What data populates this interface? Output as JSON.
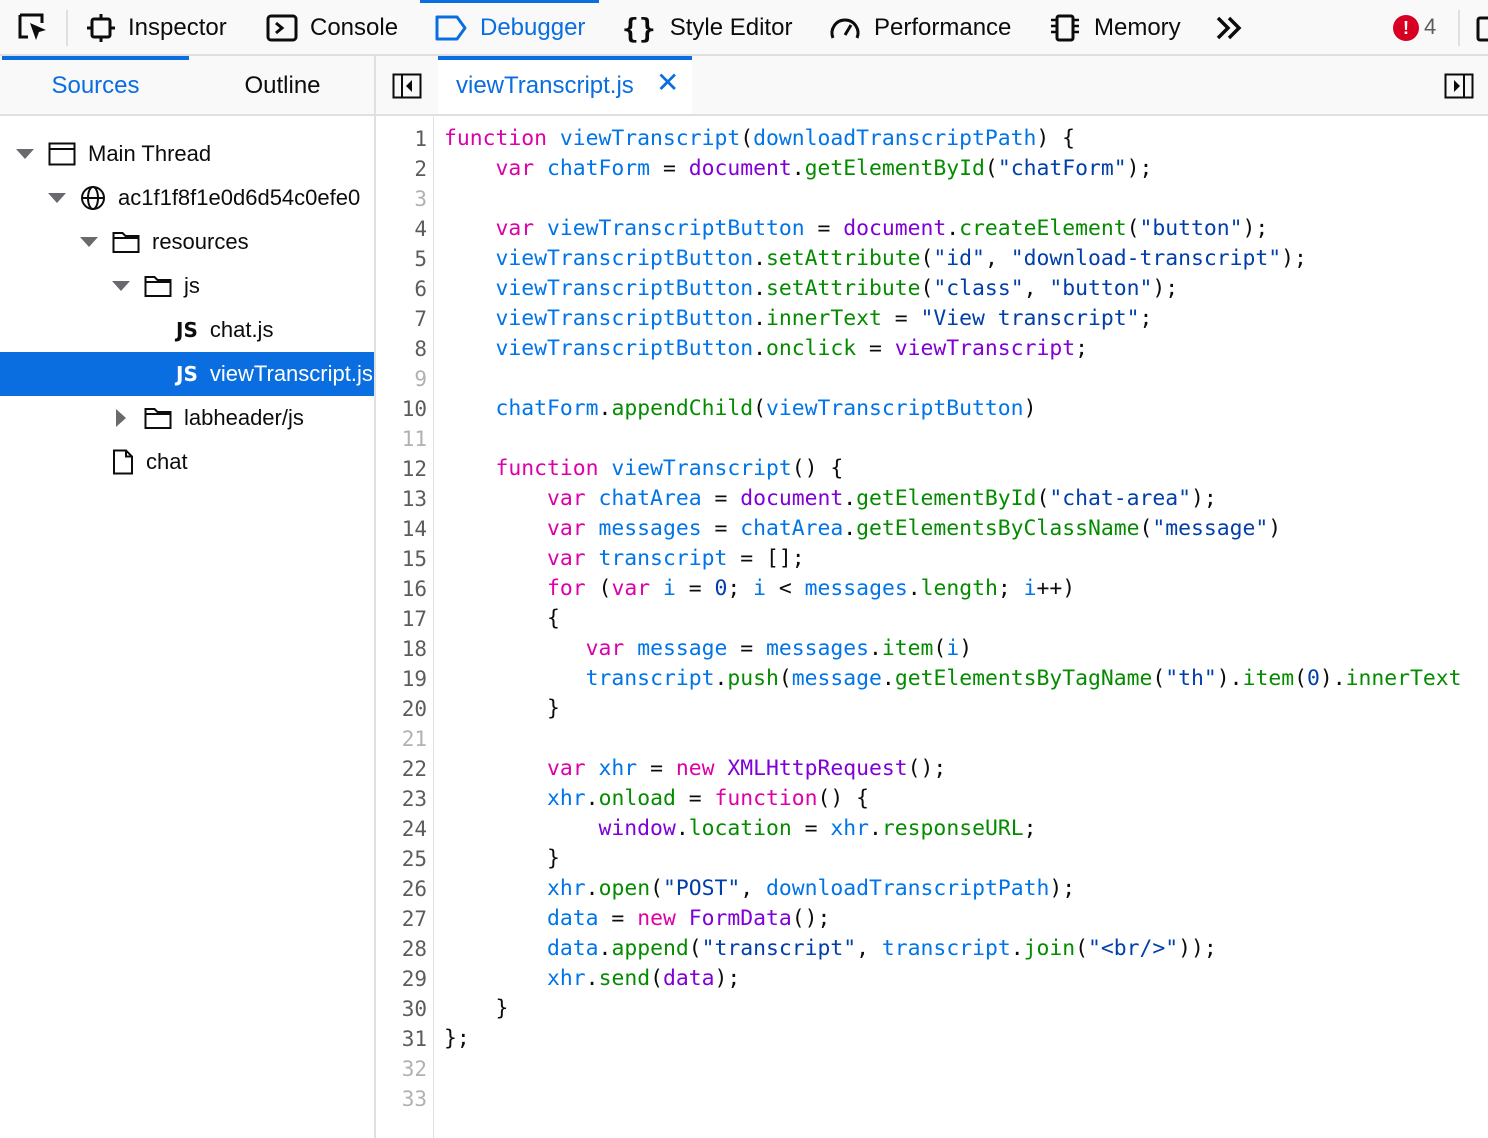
{
  "toolbar": {
    "tools": [
      {
        "id": "inspector",
        "label": "Inspector",
        "icon": "inspector-icon"
      },
      {
        "id": "console",
        "label": "Console",
        "icon": "console-icon"
      },
      {
        "id": "debugger",
        "label": "Debugger",
        "icon": "debugger-icon",
        "active": true
      },
      {
        "id": "style-editor",
        "label": "Style Editor",
        "icon": "braces-icon"
      },
      {
        "id": "performance",
        "label": "Performance",
        "icon": "gauge-icon"
      },
      {
        "id": "memory",
        "label": "Memory",
        "icon": "chip-icon"
      }
    ],
    "error_badge": "!",
    "error_count": "4",
    "accent": "#0a6ee0",
    "error_color": "#d70022"
  },
  "left_panel": {
    "tabs": [
      {
        "label": "Sources",
        "active": true
      },
      {
        "label": "Outline",
        "active": false
      }
    ],
    "tree": [
      {
        "label": "Main Thread",
        "icon": "window-icon",
        "expanded": true
      },
      {
        "label": "ac1f1f8f1e0d6d54c0efe0",
        "icon": "globe-icon",
        "expanded": true
      },
      {
        "label": "resources",
        "icon": "folder-icon",
        "expanded": true
      },
      {
        "label": "js",
        "icon": "folder-icon",
        "expanded": true
      },
      {
        "label": "chat.js",
        "icon": "js-icon"
      },
      {
        "label": "viewTranscript.js",
        "icon": "js-icon",
        "selected": true
      },
      {
        "label": "labheader/js",
        "icon": "folder-icon",
        "expanded": false
      },
      {
        "label": "chat",
        "icon": "file-icon"
      }
    ],
    "js_badge": "JS"
  },
  "editor": {
    "file_tab": "viewTranscript.js",
    "close_glyph": "✕",
    "lines": [
      [
        [
          "k",
          "function "
        ],
        [
          "v",
          "viewTranscript"
        ],
        [
          "n",
          "("
        ],
        [
          "v",
          "downloadTranscriptPath"
        ],
        [
          "n",
          ") {"
        ]
      ],
      [
        [
          "n",
          "    "
        ],
        [
          "k",
          "var "
        ],
        [
          "v",
          "chatForm"
        ],
        [
          "n",
          " = "
        ],
        [
          "u",
          "document"
        ],
        [
          "n",
          "."
        ],
        [
          "p",
          "getElementById"
        ],
        [
          "n",
          "("
        ],
        [
          "s",
          "\"chatForm\""
        ],
        [
          "n",
          ");"
        ]
      ],
      [],
      [
        [
          "n",
          "    "
        ],
        [
          "k",
          "var "
        ],
        [
          "v",
          "viewTranscriptButton"
        ],
        [
          "n",
          " = "
        ],
        [
          "u",
          "document"
        ],
        [
          "n",
          "."
        ],
        [
          "p",
          "createElement"
        ],
        [
          "n",
          "("
        ],
        [
          "s",
          "\"button\""
        ],
        [
          "n",
          ");"
        ]
      ],
      [
        [
          "n",
          "    "
        ],
        [
          "v",
          "viewTranscriptButton"
        ],
        [
          "n",
          "."
        ],
        [
          "p",
          "setAttribute"
        ],
        [
          "n",
          "("
        ],
        [
          "s",
          "\"id\""
        ],
        [
          "n",
          ", "
        ],
        [
          "s",
          "\"download-transcript\""
        ],
        [
          "n",
          ");"
        ]
      ],
      [
        [
          "n",
          "    "
        ],
        [
          "v",
          "viewTranscriptButton"
        ],
        [
          "n",
          "."
        ],
        [
          "p",
          "setAttribute"
        ],
        [
          "n",
          "("
        ],
        [
          "s",
          "\"class\""
        ],
        [
          "n",
          ", "
        ],
        [
          "s",
          "\"button\""
        ],
        [
          "n",
          ");"
        ]
      ],
      [
        [
          "n",
          "    "
        ],
        [
          "v",
          "viewTranscriptButton"
        ],
        [
          "n",
          "."
        ],
        [
          "p",
          "innerText"
        ],
        [
          "n",
          " = "
        ],
        [
          "s",
          "\"View transcript\""
        ],
        [
          "n",
          ";"
        ]
      ],
      [
        [
          "n",
          "    "
        ],
        [
          "v",
          "viewTranscriptButton"
        ],
        [
          "n",
          "."
        ],
        [
          "p",
          "onclick"
        ],
        [
          "n",
          " = "
        ],
        [
          "u",
          "viewTranscript"
        ],
        [
          "n",
          ";"
        ]
      ],
      [],
      [
        [
          "n",
          "    "
        ],
        [
          "v",
          "chatForm"
        ],
        [
          "n",
          "."
        ],
        [
          "p",
          "appendChild"
        ],
        [
          "n",
          "("
        ],
        [
          "v",
          "viewTranscriptButton"
        ],
        [
          "n",
          ")"
        ]
      ],
      [],
      [
        [
          "n",
          "    "
        ],
        [
          "k",
          "function "
        ],
        [
          "v",
          "viewTranscript"
        ],
        [
          "n",
          "() {"
        ]
      ],
      [
        [
          "n",
          "        "
        ],
        [
          "k",
          "var "
        ],
        [
          "v",
          "chatArea"
        ],
        [
          "n",
          " = "
        ],
        [
          "u",
          "document"
        ],
        [
          "n",
          "."
        ],
        [
          "p",
          "getElementById"
        ],
        [
          "n",
          "("
        ],
        [
          "s",
          "\"chat-area\""
        ],
        [
          "n",
          ");"
        ]
      ],
      [
        [
          "n",
          "        "
        ],
        [
          "k",
          "var "
        ],
        [
          "v",
          "messages"
        ],
        [
          "n",
          " = "
        ],
        [
          "v",
          "chatArea"
        ],
        [
          "n",
          "."
        ],
        [
          "p",
          "getElementsByClassName"
        ],
        [
          "n",
          "("
        ],
        [
          "s",
          "\"message\""
        ],
        [
          "n",
          ")"
        ]
      ],
      [
        [
          "n",
          "        "
        ],
        [
          "k",
          "var "
        ],
        [
          "v",
          "transcript"
        ],
        [
          "n",
          " = [];"
        ]
      ],
      [
        [
          "n",
          "        "
        ],
        [
          "k",
          "for "
        ],
        [
          "n",
          "("
        ],
        [
          "k",
          "var "
        ],
        [
          "v",
          "i"
        ],
        [
          "n",
          " = "
        ],
        [
          "s",
          "0"
        ],
        [
          "n",
          "; "
        ],
        [
          "v",
          "i"
        ],
        [
          "n",
          " < "
        ],
        [
          "v",
          "messages"
        ],
        [
          "n",
          "."
        ],
        [
          "p",
          "length"
        ],
        [
          "n",
          "; "
        ],
        [
          "v",
          "i"
        ],
        [
          "n",
          "++)"
        ]
      ],
      [
        [
          "n",
          "        {"
        ]
      ],
      [
        [
          "n",
          "           "
        ],
        [
          "k",
          "var "
        ],
        [
          "v",
          "message"
        ],
        [
          "n",
          " = "
        ],
        [
          "v",
          "messages"
        ],
        [
          "n",
          "."
        ],
        [
          "p",
          "item"
        ],
        [
          "n",
          "("
        ],
        [
          "v",
          "i"
        ],
        [
          "n",
          ")"
        ]
      ],
      [
        [
          "n",
          "           "
        ],
        [
          "v",
          "transcript"
        ],
        [
          "n",
          "."
        ],
        [
          "p",
          "push"
        ],
        [
          "n",
          "("
        ],
        [
          "v",
          "message"
        ],
        [
          "n",
          "."
        ],
        [
          "p",
          "getElementsByTagName"
        ],
        [
          "n",
          "("
        ],
        [
          "s",
          "\"th\""
        ],
        [
          "n",
          ")."
        ],
        [
          "p",
          "item"
        ],
        [
          "n",
          "("
        ],
        [
          "s",
          "0"
        ],
        [
          "n",
          ")."
        ],
        [
          "p",
          "innerText"
        ]
      ],
      [
        [
          "n",
          "        }"
        ]
      ],
      [],
      [
        [
          "n",
          "        "
        ],
        [
          "k",
          "var "
        ],
        [
          "v",
          "xhr"
        ],
        [
          "n",
          " = "
        ],
        [
          "k",
          "new "
        ],
        [
          "u",
          "XMLHttpRequest"
        ],
        [
          "n",
          "();"
        ]
      ],
      [
        [
          "n",
          "        "
        ],
        [
          "v",
          "xhr"
        ],
        [
          "n",
          "."
        ],
        [
          "p",
          "onload"
        ],
        [
          "n",
          " = "
        ],
        [
          "k",
          "function"
        ],
        [
          "n",
          "() {"
        ]
      ],
      [
        [
          "n",
          "            "
        ],
        [
          "u",
          "window"
        ],
        [
          "n",
          "."
        ],
        [
          "p",
          "location"
        ],
        [
          "n",
          " = "
        ],
        [
          "v",
          "xhr"
        ],
        [
          "n",
          "."
        ],
        [
          "p",
          "responseURL"
        ],
        [
          "n",
          ";"
        ]
      ],
      [
        [
          "n",
          "        }"
        ]
      ],
      [
        [
          "n",
          "        "
        ],
        [
          "v",
          "xhr"
        ],
        [
          "n",
          "."
        ],
        [
          "p",
          "open"
        ],
        [
          "n",
          "("
        ],
        [
          "s",
          "\"POST\""
        ],
        [
          "n",
          ", "
        ],
        [
          "v",
          "downloadTranscriptPath"
        ],
        [
          "n",
          ");"
        ]
      ],
      [
        [
          "n",
          "        "
        ],
        [
          "v",
          "data"
        ],
        [
          "n",
          " = "
        ],
        [
          "k",
          "new "
        ],
        [
          "u",
          "FormData"
        ],
        [
          "n",
          "();"
        ]
      ],
      [
        [
          "n",
          "        "
        ],
        [
          "v",
          "data"
        ],
        [
          "n",
          "."
        ],
        [
          "p",
          "append"
        ],
        [
          "n",
          "("
        ],
        [
          "s",
          "\"transcript\""
        ],
        [
          "n",
          ", "
        ],
        [
          "v",
          "transcript"
        ],
        [
          "n",
          "."
        ],
        [
          "p",
          "join"
        ],
        [
          "n",
          "("
        ],
        [
          "s",
          "\"<br/>\""
        ],
        [
          "n",
          "));"
        ]
      ],
      [
        [
          "n",
          "        "
        ],
        [
          "v",
          "xhr"
        ],
        [
          "n",
          "."
        ],
        [
          "p",
          "send"
        ],
        [
          "n",
          "("
        ],
        [
          "u",
          "data"
        ],
        [
          "n",
          ");"
        ]
      ],
      [
        [
          "n",
          "    }"
        ]
      ],
      [
        [
          "n",
          "};"
        ]
      ],
      [],
      []
    ]
  }
}
